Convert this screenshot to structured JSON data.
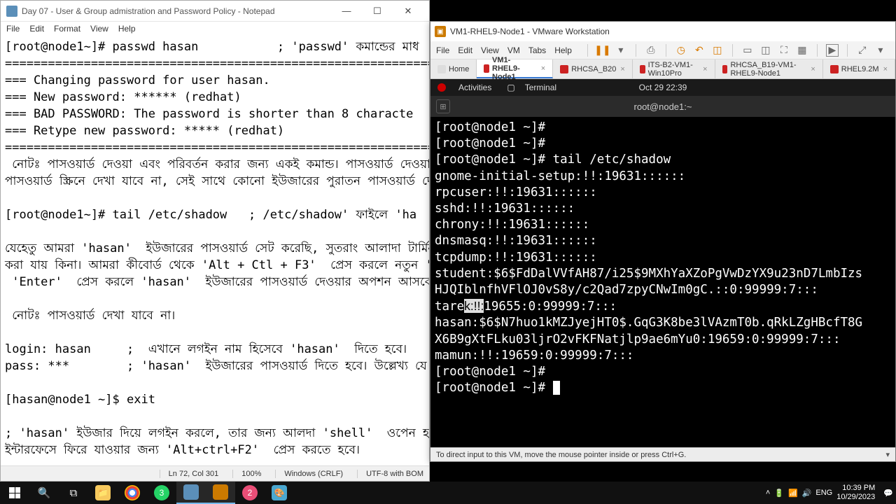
{
  "notepad": {
    "title": "Day 07 - User & Group admistration and Password Policy - Notepad",
    "menu": [
      "File",
      "Edit",
      "Format",
      "View",
      "Help"
    ],
    "content_lines": [
      "[root@node1~]# passwd hasan           ; 'passwd' কমান্ডের মাধ",
      "=============================================================",
      "=== Changing password for user hasan.",
      "=== New password: ****** (redhat)",
      "=== BAD PASSWORD: The password is shorter than 8 characte",
      "=== Retype new password: ***** (redhat)",
      "=============================================================",
      " নোটঃ পাসওয়ার্ড দেওয়া এবং পরিবর্তন করার জন্য একই কমান্ড। পাসওয়ার্ড দেওয়া",
      "পাসওয়ার্ড স্ক্রিনে দেখা যাবে না, সেই সাথে কোনো ইউজারের পুরাতন পাসওয়ার্ড দে",
      "",
      "[root@node1~]# tail /etc/shadow   ; /etc/shadow' ফাইলে 'ha",
      "",
      "যেহেতু আমরা 'hasan'  ইউজারের পাসওয়ার্ড সেট করেছি, সুতরাং আলাদা টার্মিন",
      "করা যায় কিনা। আমরা কীবোর্ড থেকে 'Alt + Ctl + F3'  প্রেস করলে নতুন 'L",
      " 'Enter'  প্রেস করলে 'hasan'  ইউজারের পাসওয়ার্ড দেওয়ার অপশন আসবে। এ",
      "",
      " নোটঃ পাসওয়ার্ড দেখা যাবে না।",
      "",
      "login: hasan     ;  এখানে লগইন নাম হিসেবে 'hasan'  দিতে হবে।",
      "pass: ***        ; 'hasan'  ইউজারের পাসওয়ার্ড দিতে হবে। উল্লেখ্য যে,",
      "",
      "[hasan@node1 ~]$ exit",
      "",
      "; 'hasan' ইউজার দিয়ে লগইন করলে, তার জন্য আলদা 'shell'  ওপেন হবে",
      "ইন্টারফেসে ফিরে যাওয়ার জন্য 'Alt+ctrl+F2'  প্রেস করতে হবে।",
      ""
    ],
    "status": {
      "pos": "Ln 72, Col 301",
      "zoom": "100%",
      "eol": "Windows (CRLF)",
      "enc": "UTF-8 with BOM"
    }
  },
  "vmware": {
    "title": "VM1-RHEL9-Node1 - VMware Workstation",
    "menu": [
      "File",
      "Edit",
      "View",
      "VM",
      "Tabs",
      "Help"
    ],
    "tabs": [
      {
        "label": "Home",
        "home": true
      },
      {
        "label": "VM1-RHEL9-Node1",
        "active": true
      },
      {
        "label": "RHCSA_B20"
      },
      {
        "label": "ITS-B2-VM1-Win10Pro"
      },
      {
        "label": "RHCSA_B19-VM1-RHEL9-Node1"
      },
      {
        "label": "RHEL9.2M"
      }
    ],
    "gnome": {
      "activities": "Activities",
      "terminal": "Terminal",
      "clock": "Oct 29  22:39"
    },
    "term_title": "root@node1:~",
    "term_lines": [
      "[root@node1 ~]# ",
      "[root@node1 ~]# ",
      "[root@node1 ~]# tail /etc/shadow",
      "gnome-initial-setup:!!:19631::::::",
      "rpcuser:!!:19631::::::",
      "sshd:!!:19631::::::",
      "chrony:!!:19631::::::",
      "dnsmasq:!!:19631::::::",
      "tcpdump:!!:19631::::::",
      "student:$6$FdDalVVfAH87/i25$9MXhYaXZoPgVwDzYX9u23nD7LmbIzs",
      "HJQIblnfhVFlOJ0vS8y/c2Qad7zpyCNwIm0gC.::0:99999:7:::"
    ],
    "term_sel_pre": "tare",
    "term_sel": "k:!!:",
    "term_sel_post": "19655:0:99999:7:::",
    "term_after": [
      "hasan:$6$N7huo1kMZJyejHT0$.GqG3K8be3lVAzmT0b.qRkLZgHBcfT8G",
      "X6B9gXtFLku03ljrO2vFKFNatjlp9ae6mYu0:19659:0:99999:7:::",
      "mamun:!!:19659:0:99999:7:::",
      "[root@node1 ~]# ",
      "[root@node1 ~]# "
    ],
    "hint": "To direct input to this VM, move the mouse pointer inside or press Ctrl+G."
  },
  "taskbar": {
    "time": "10:39 PM",
    "date": "10/29/2023"
  }
}
